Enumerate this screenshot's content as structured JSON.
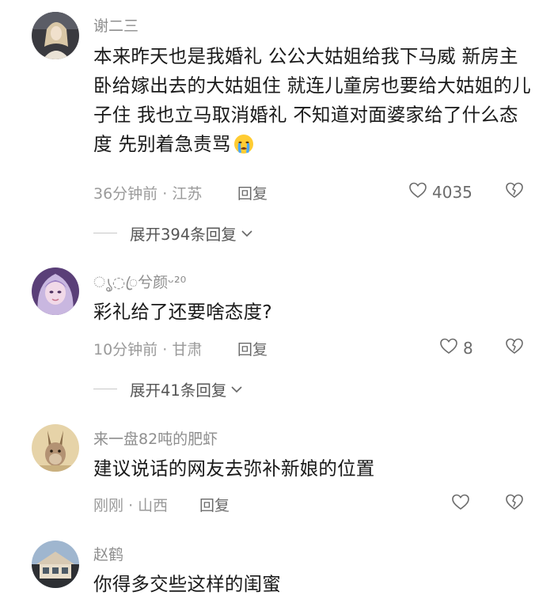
{
  "comments": [
    {
      "username": "谢二三",
      "content": "本来昨天也是我婚礼 公公大姑姐给我下马威 新房主卧给嫁出去的大姑姐住 就连儿童房也要给大姑姐的儿子住 我也立马取消婚礼 不知道对面婆家给了什么态度 先别着急责骂",
      "emoji": "crying-face-emoji",
      "time": "36分钟前",
      "location": "江苏",
      "reply_label": "回复",
      "likes": "4035",
      "expand_label": "展开394条回复"
    },
    {
      "username": "ൃ◌ꦿ兮颜ᵕ²⁰",
      "content": "彩礼给了还要啥态度?",
      "time": "10分钟前",
      "location": "甘肃",
      "reply_label": "回复",
      "likes": "8",
      "expand_label": "展开41条回复"
    },
    {
      "username": "来一盘82吨的肥虾",
      "content": "建议说话的网友去弥补新娘的位置",
      "time": "刚刚",
      "location": "山西",
      "reply_label": "回复",
      "likes": ""
    },
    {
      "username": "赵鹤",
      "content": "你得多交些这样的闺蜜"
    }
  ],
  "meta_separator": "·",
  "icons": {
    "like": "heart-outline-icon",
    "dislike": "broken-heart-icon",
    "expand": "chevron-down-icon"
  },
  "colors": {
    "text": "#1a1a1a",
    "username": "#8e8e8e",
    "meta": "#9a9a9a"
  }
}
